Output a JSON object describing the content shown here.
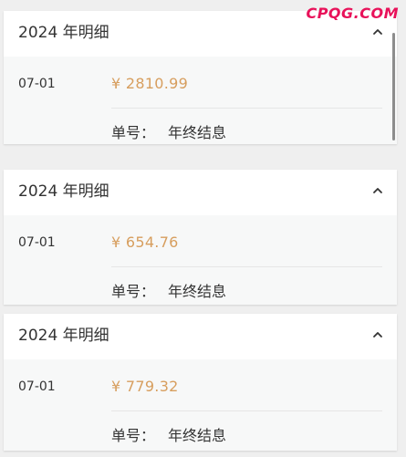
{
  "watermark": "CPQG.COM",
  "cards": [
    {
      "title": "2024 年明细",
      "date": "07-01",
      "amount": "¥ 2810.99",
      "order_label": "单号：",
      "order_value": "年终结息"
    },
    {
      "title": "2024 年明细",
      "date": "07-01",
      "amount": "¥ 654.76",
      "order_label": "单号：",
      "order_value": "年终结息"
    },
    {
      "title": "2024 年明细",
      "date": "07-01",
      "amount": "¥ 779.32",
      "order_label": "单号：",
      "order_value": "年终结息"
    }
  ],
  "icons": {
    "collapse": "chevron-up-icon"
  },
  "colors": {
    "amount": "#d79e5e",
    "watermark": "#e8125a",
    "body_bg": "#f7f8f8"
  }
}
